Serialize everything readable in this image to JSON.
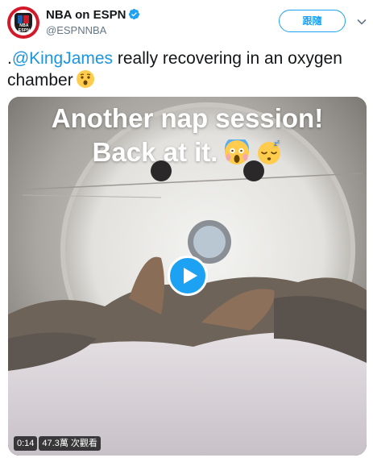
{
  "account": {
    "display_name": "NBA on ESPN",
    "handle": "@ESPNNBA",
    "verified": true,
    "avatar_label": "NBA ESPN"
  },
  "actions": {
    "follow_label": "跟隨",
    "menu_icon": "chevron-down-icon"
  },
  "tweet": {
    "prefix": ".",
    "mention": "@KingJames",
    "body": " really recovering in an oxygen chamber",
    "emoji": "hushed-face-emoji"
  },
  "media": {
    "overlay_line_1": "Another nap session!",
    "overlay_line_2": "Back at it.",
    "overlay_emojis": [
      "screaming-face-emoji",
      "sleeping-face-emoji"
    ],
    "duration": "0:14",
    "views": "47.3萬 次觀看",
    "play_icon": "play-icon"
  },
  "colors": {
    "accent": "#1da1f2",
    "mention": "#1b95e0",
    "text": "#14171a",
    "secondary": "#657786"
  }
}
